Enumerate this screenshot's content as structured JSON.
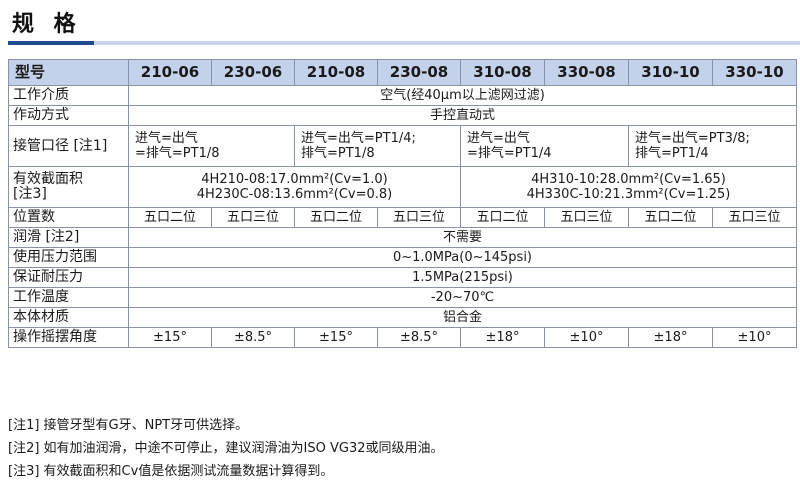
{
  "title": "规 格",
  "header": {
    "model_label": "型号",
    "models": [
      "210-06",
      "230-06",
      "210-08",
      "230-08",
      "310-08",
      "330-08",
      "310-10",
      "330-10"
    ]
  },
  "rows": {
    "medium": {
      "label": "工作介质",
      "value": "空气(经40μm以上滤网过滤)"
    },
    "action": {
      "label": "作动方式",
      "value": "手控直动式"
    },
    "port": {
      "label": "接管口径 [注1]",
      "g1": {
        "l1": "进气=出气",
        "l2": "=排气=PT1/8"
      },
      "g2": {
        "l1": "进气=出气=PT1/4;",
        "l2": "排气=PT1/8"
      },
      "g3": {
        "l1": "进气=出气",
        "l2": "=排气=PT1/4"
      },
      "g4": {
        "l1": "进气=出气=PT3/8;",
        "l2": "排气=PT1/4"
      }
    },
    "area": {
      "label1": "有效截面积",
      "label2": "[注3]",
      "a_l1": "4H210-08:17.0mm²(Cv=1.0)",
      "a_l2": "4H230C-08:13.6mm²(Cv=0.8)",
      "b_l1": "4H310-10:28.0mm²(Cv=1.65)",
      "b_l2": "4H330C-10:21.3mm²(Cv=1.25)"
    },
    "positions": {
      "label": "位置数",
      "values": [
        "五口二位",
        "五口三位",
        "五口二位",
        "五口三位",
        "五口二位",
        "五口三位",
        "五口二位",
        "五口三位"
      ]
    },
    "lube": {
      "label": "润滑 [注2]",
      "value": "不需要"
    },
    "pressure": {
      "label": "使用压力范围",
      "value": "0~1.0MPa(0~145psi)"
    },
    "proof": {
      "label": "保证耐压力",
      "value": "1.5MPa(215psi)"
    },
    "temp": {
      "label": "工作温度",
      "value": "-20~70℃"
    },
    "material": {
      "label": "本体材质",
      "value": "铝合金"
    },
    "angle": {
      "label": "操作摇摆角度",
      "values": [
        "±15°",
        "±8.5°",
        "±15°",
        "±8.5°",
        "±18°",
        "±10°",
        "±18°",
        "±10°"
      ]
    }
  },
  "notes": [
    "[注1] 接管牙型有G牙、NPT牙可供选择。",
    "[注2] 如有加油润滑，中途不可停止，建议润滑油为ISO VG32或同级用油。",
    "[注3] 有效截面积和Cv值是依据测试流量数据计算得到。"
  ]
}
